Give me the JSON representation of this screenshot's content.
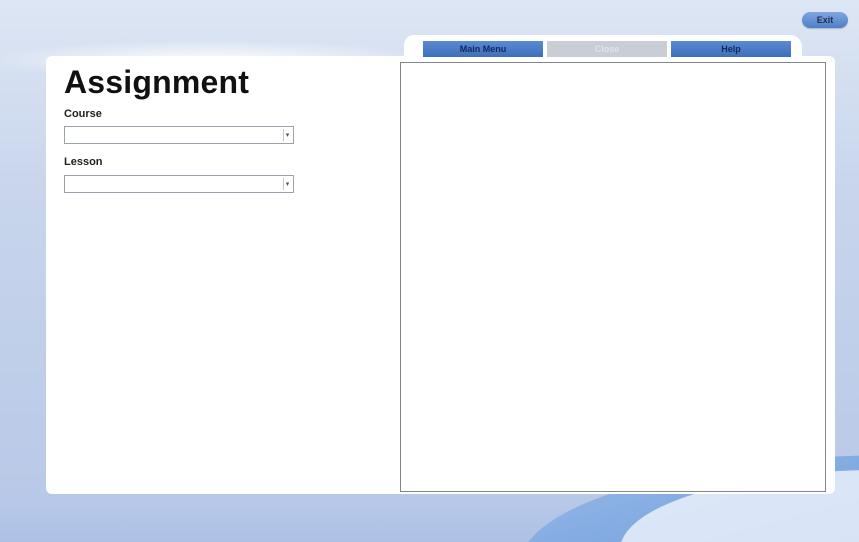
{
  "header": {
    "exit_label": "Exit"
  },
  "tabs": [
    {
      "label": "Main Menu",
      "state": "active"
    },
    {
      "label": "Close",
      "state": "disabled"
    },
    {
      "label": "Help",
      "state": "active"
    }
  ],
  "page": {
    "title": "Assignment"
  },
  "form": {
    "course_label": "Course",
    "course_value": "",
    "lesson_label": "Lesson",
    "lesson_value": ""
  },
  "colors": {
    "tab_active": "#4a7cc4",
    "tab_disabled": "#c9ced6",
    "background": "#c8d5ec"
  }
}
